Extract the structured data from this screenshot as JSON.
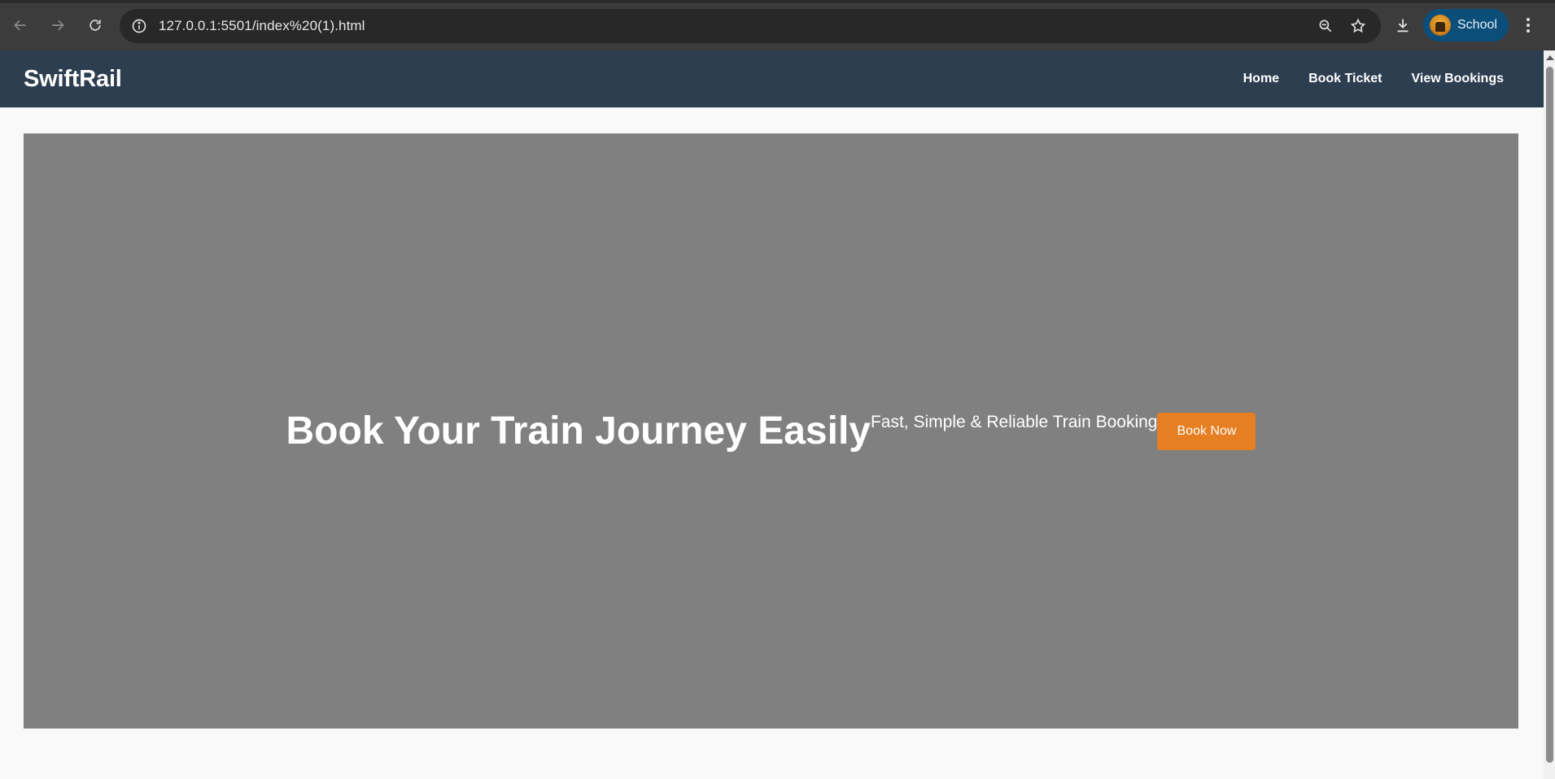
{
  "browser": {
    "url": "127.0.0.1:5501/index%20(1).html",
    "profile_label": "School",
    "profile_color": "#0b4e7a"
  },
  "icons": {
    "back": "arrow-left-icon",
    "forward": "arrow-right-icon",
    "reload": "reload-icon",
    "site_info": "info-icon",
    "zoom": "zoom-out-icon",
    "bookmark": "star-icon",
    "downloads": "download-icon",
    "menu": "kebab-menu-icon"
  },
  "site": {
    "brand": "SwiftRail",
    "nav": {
      "home": "Home",
      "book_ticket": "Book Ticket",
      "view_bookings": "View Bookings"
    },
    "nav_color": "#2c3e50"
  },
  "hero": {
    "title": "Book Your Train Journey Easily",
    "subtitle": "Fast, Simple & Reliable Train Booking",
    "cta_label": "Book Now",
    "background": "#808080",
    "cta_color": "#e67e22"
  }
}
